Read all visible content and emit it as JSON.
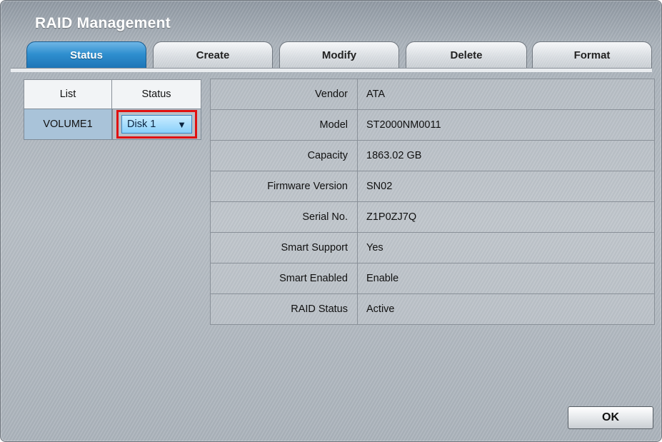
{
  "window": {
    "title": "RAID Management"
  },
  "tabs": [
    {
      "label": "Status",
      "active": true
    },
    {
      "label": "Create",
      "active": false
    },
    {
      "label": "Modify",
      "active": false
    },
    {
      "label": "Delete",
      "active": false
    },
    {
      "label": "Format",
      "active": false
    }
  ],
  "list": {
    "headers": [
      "List",
      "Status"
    ],
    "rows": [
      {
        "volume": "VOLUME1",
        "status_select": "Disk 1"
      }
    ]
  },
  "details": [
    {
      "key": "Vendor",
      "value": "ATA"
    },
    {
      "key": "Model",
      "value": "ST2000NM0011"
    },
    {
      "key": "Capacity",
      "value": "1863.02 GB"
    },
    {
      "key": "Firmware Version",
      "value": "SN02"
    },
    {
      "key": "Serial No.",
      "value": "Z1P0ZJ7Q"
    },
    {
      "key": "Smart Support",
      "value": "Yes"
    },
    {
      "key": "Smart Enabled",
      "value": "Enable"
    },
    {
      "key": "RAID Status",
      "value": "Active"
    }
  ],
  "buttons": {
    "ok": "OK"
  },
  "icons": {
    "select_caret": "caret-down-icon"
  },
  "colors": {
    "active_tab": "#2f8fcf",
    "highlight_border": "#e01010"
  }
}
